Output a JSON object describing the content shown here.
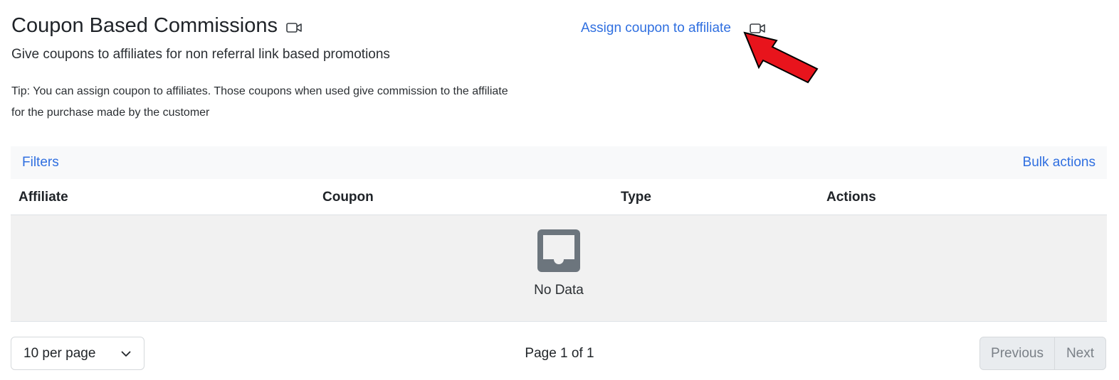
{
  "header": {
    "title": "Coupon Based Commissions",
    "subtitle": "Give coupons to affiliates for non referral link based promotions",
    "tip": "Tip: You can assign coupon to affiliates. Those coupons when used give commission to the affiliate for the purchase made by the customer",
    "assign_link": "Assign coupon to affiliate",
    "video_icon": "video-camera-icon"
  },
  "toolbar": {
    "filters_label": "Filters",
    "bulk_label": "Bulk actions"
  },
  "table": {
    "columns": [
      "Affiliate",
      "Coupon",
      "Type",
      "Actions"
    ],
    "empty_text": "No Data",
    "empty_icon": "inbox-icon"
  },
  "footer": {
    "per_page": "10 per page",
    "page_info": "Page 1 of 1",
    "prev_label": "Previous",
    "next_label": "Next"
  },
  "annotation": {
    "arrow_icon": "red-arrow-icon",
    "arrow_color": "#e8141c"
  },
  "colors": {
    "link": "#2f6fe0",
    "empty_bg": "#f1f1f1",
    "inbox_icon": "#6c757d"
  }
}
